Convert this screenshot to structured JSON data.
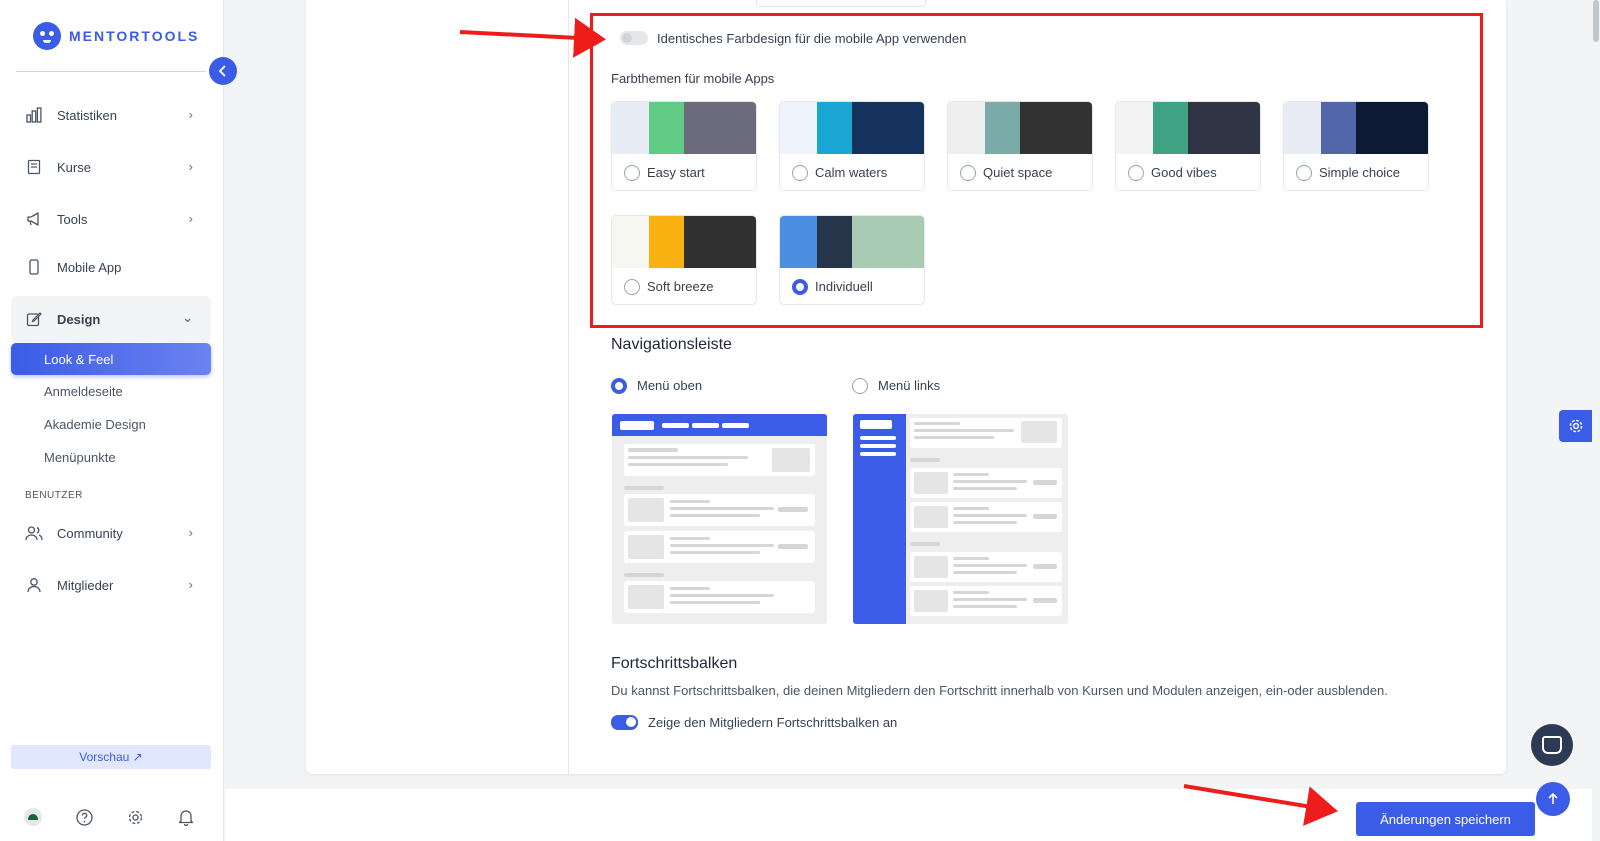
{
  "brand": {
    "name": "MENTORTOOLS",
    "accent": "#3b5ce6"
  },
  "sidebar": {
    "items": [
      {
        "label": "Statistiken",
        "icon": "bar-chart-icon"
      },
      {
        "label": "Kurse",
        "icon": "book-icon"
      },
      {
        "label": "Tools",
        "icon": "megaphone-icon"
      },
      {
        "label": "Mobile App",
        "icon": "phone-icon"
      },
      {
        "label": "Design",
        "icon": "pencil-square-icon"
      }
    ],
    "design_sub": [
      "Look & Feel",
      "Anmeldeseite",
      "Akademie Design",
      "Menüpunkte"
    ],
    "section_label": "BENUTZER",
    "user_items": [
      {
        "label": "Community",
        "icon": "users-icon"
      },
      {
        "label": "Mitglieder",
        "icon": "user-icon"
      }
    ],
    "preview_label": "Vorschau ↗"
  },
  "mobile_colors": {
    "toggle_label": "Identisches Farbdesign für die mobile App verwenden",
    "toggle_on": false,
    "section_title": "Farbthemen für mobile Apps",
    "themes": [
      {
        "label": "Easy start",
        "colors": [
          "#e8ecf6",
          "#5fcb84",
          "#6c6b7c"
        ],
        "selected": false
      },
      {
        "label": "Calm waters",
        "colors": [
          "#eef4fc",
          "#1aa7d3",
          "#15325f"
        ],
        "selected": false
      },
      {
        "label": "Quiet space",
        "colors": [
          "#eeeeee",
          "#7aaba8",
          "#323232"
        ],
        "selected": false
      },
      {
        "label": "Good vibes",
        "colors": [
          "#f3f3f3",
          "#3fa283",
          "#2f3544"
        ],
        "selected": false
      },
      {
        "label": "Simple choice",
        "colors": [
          "#e9ebf5",
          "#5167aa",
          "#0c1a34"
        ],
        "selected": false
      },
      {
        "label": "Soft breeze",
        "colors": [
          "#f6f7f1",
          "#f8b111",
          "#313131"
        ],
        "selected": false
      },
      {
        "label": "Individuell",
        "colors": [
          "#4b8fe0",
          "#263549",
          "#a9cbb4"
        ],
        "selected": true
      }
    ]
  },
  "navigation": {
    "title": "Navigationsleiste",
    "options": [
      {
        "label": "Menü oben",
        "selected": true
      },
      {
        "label": "Menü links",
        "selected": false
      }
    ]
  },
  "progress": {
    "title": "Fortschrittsbalken",
    "description": "Du kannst Fortschrittsbalken, die deinen Mitgliedern den Fortschritt innerhalb von Kursen und Modulen anzeigen, ein-oder ausblenden.",
    "toggle_label": "Zeige den Mitgliedern Fortschrittsbalken an",
    "toggle_on": true
  },
  "save_label": "Änderungen speichern",
  "annotation_color": "#ef1c1c"
}
